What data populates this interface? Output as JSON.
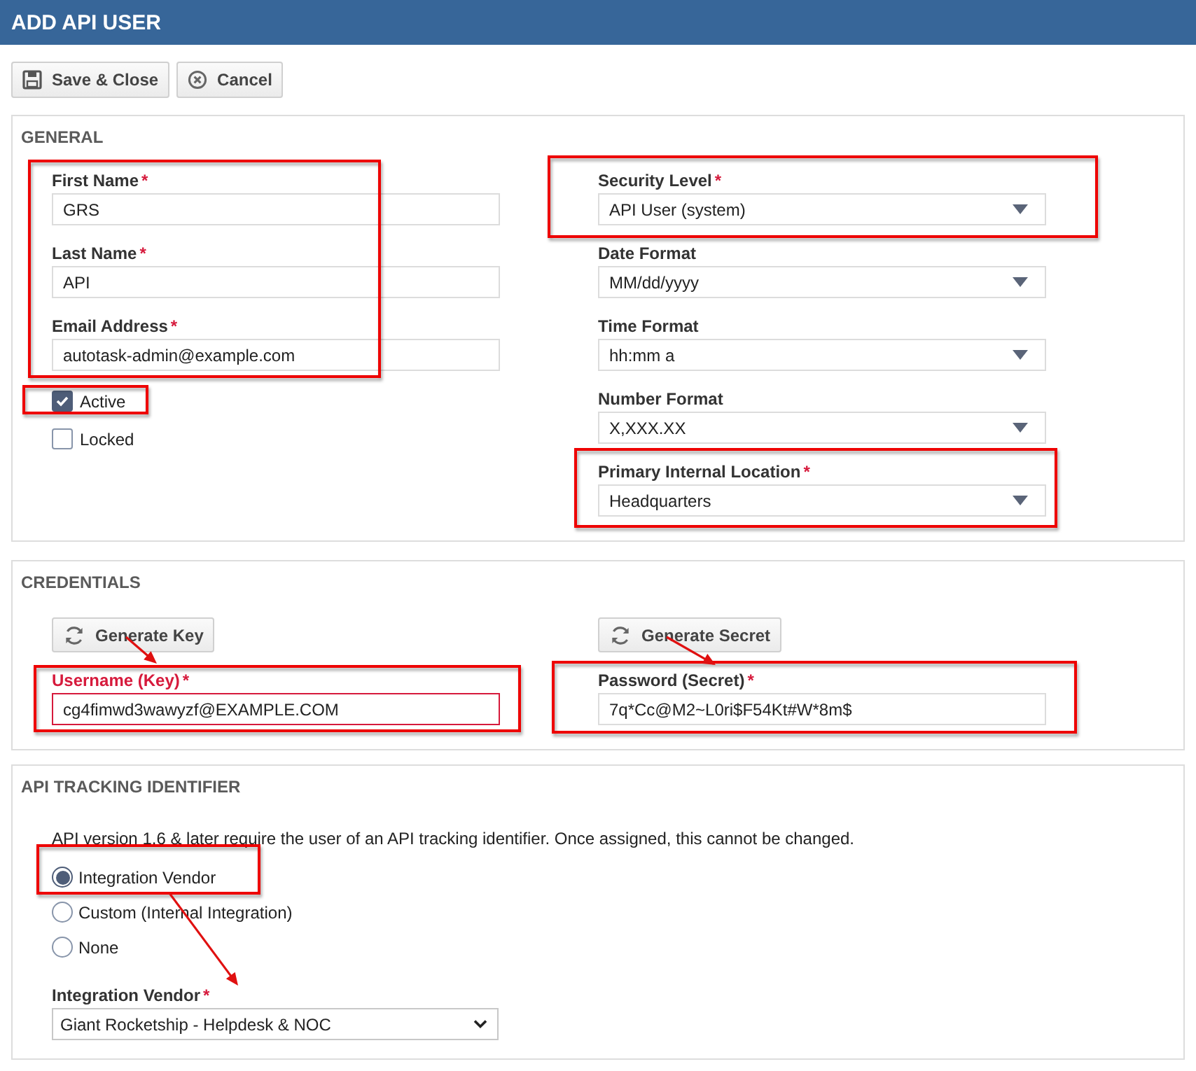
{
  "window": {
    "title": "ADD API USER"
  },
  "toolbar": [
    {
      "label": "Save & Close"
    },
    {
      "label": "Cancel"
    }
  ],
  "general": {
    "title": "GENERAL",
    "left_fields": [
      {
        "label": "First Name",
        "required_mark": "*",
        "value": "GRS"
      },
      {
        "label": "Last Name",
        "required_mark": "*",
        "value": "API"
      },
      {
        "label": "Email Address",
        "required_mark": "*",
        "value": "autotask-admin@example.com"
      }
    ],
    "checkboxes": [
      {
        "label": "Active",
        "checked": true
      },
      {
        "label": "Locked",
        "checked": false
      }
    ],
    "right_fields": [
      {
        "label": "Security Level",
        "required_mark": "*",
        "value": "API User (system)"
      },
      {
        "label": "Date Format",
        "value": "MM/dd/yyyy"
      },
      {
        "label": "Time Format",
        "value": "hh:mm a"
      },
      {
        "label": "Number Format",
        "value": "X,XXX.XX"
      },
      {
        "label": "Primary Internal Location",
        "required_mark": "*",
        "value": "Headquarters"
      }
    ]
  },
  "credentials": {
    "title": "CREDENTIALS",
    "columns": [
      {
        "button": "Generate Key",
        "label": "Username (Key)",
        "required_mark": "*",
        "error": true,
        "value": "cg4fimwd3wawyzf@EXAMPLE.COM"
      },
      {
        "button": "Generate Secret",
        "label": "Password (Secret)",
        "required_mark": "*",
        "error": false,
        "value": "7q*Cc@M2~L0ri$F54Kt#W*8m$"
      }
    ]
  },
  "tracking": {
    "title": "API TRACKING IDENTIFIER",
    "note": "API version 1.6 & later require the user of an API tracking identifier. Once assigned, this cannot be changed.",
    "options": [
      {
        "label": "Integration Vendor",
        "selected": true
      },
      {
        "label": "Custom (Internal Integration)",
        "selected": false
      },
      {
        "label": "None",
        "selected": false
      }
    ],
    "vendor": {
      "label": "Integration Vendor",
      "required_mark": "*",
      "value": "Giant Rocketship - Helpdesk & NOC"
    }
  },
  "annotations": [
    {
      "kind": "box"
    },
    {
      "kind": "box"
    },
    {
      "kind": "box"
    },
    {
      "kind": "box"
    },
    {
      "kind": "box"
    },
    {
      "kind": "box"
    },
    {
      "kind": "box"
    },
    {
      "kind": "arrow"
    },
    {
      "kind": "arrow"
    },
    {
      "kind": "arrow"
    }
  ]
}
